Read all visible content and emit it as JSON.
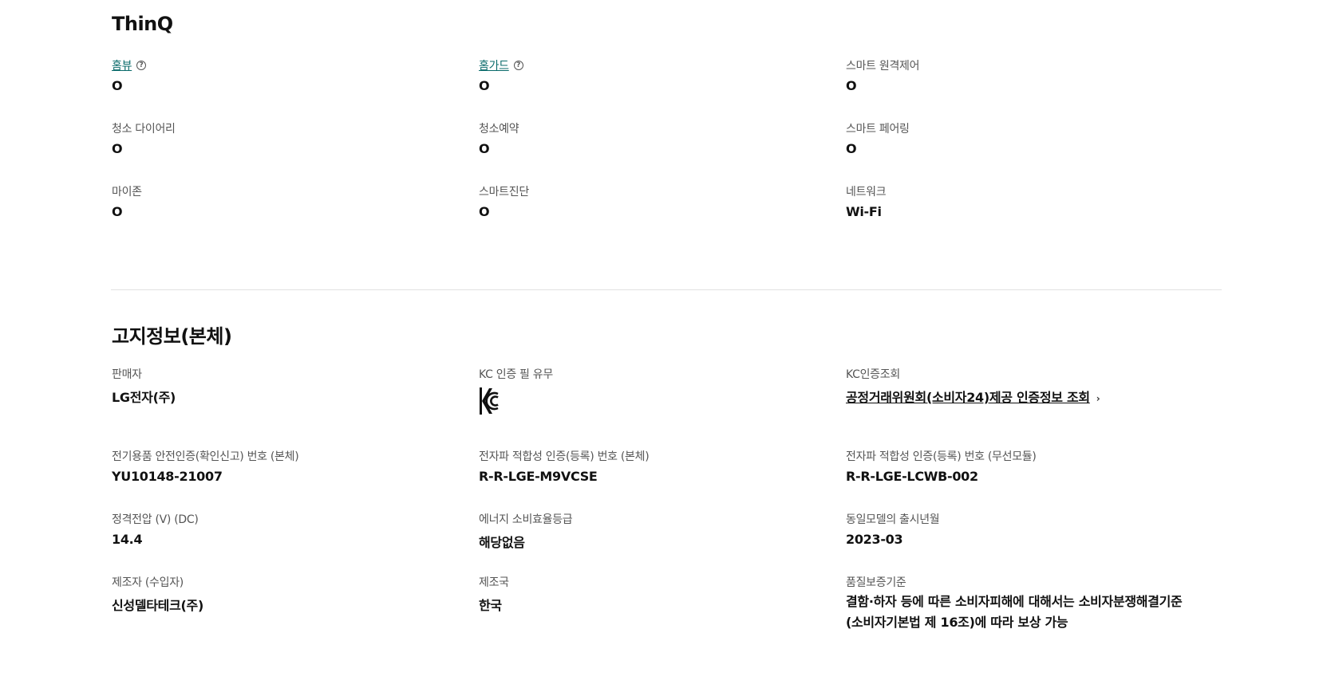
{
  "thinq": {
    "title": "ThinQ",
    "items": [
      {
        "label": "홈뷰",
        "value": "O"
      },
      {
        "label": "홈가드",
        "value": "O"
      },
      {
        "label": "스마트 원격제어",
        "value": "O"
      },
      {
        "label": "청소 다이어리",
        "value": "O"
      },
      {
        "label": "청소예약",
        "value": "O"
      },
      {
        "label": "스마트 페어링",
        "value": "O"
      },
      {
        "label": "마이존",
        "value": "O"
      },
      {
        "label": "스마트진단",
        "value": "O"
      },
      {
        "label": "네트워크",
        "value": "Wi-Fi"
      }
    ],
    "help_icon_name": "question-circle-icon"
  },
  "notice": {
    "title": "고지정보(본체)",
    "items": [
      {
        "label": "판매자",
        "value": "LG전자(주)"
      },
      {
        "label": "KC 인증 필 유무",
        "value_icon": "kc-certification-mark-icon"
      },
      {
        "label": "KC인증조회",
        "value": "공정거래위원회(소비자24)제공 인증정보 조회"
      },
      {
        "label": "전기용품 안전인증(확인신고) 번호 (본체)",
        "value": "YU10148-21007"
      },
      {
        "label": "전자파 적합성 인증(등록) 번호 (본체)",
        "value": "R-R-LGE-M9VCSE"
      },
      {
        "label": "전자파 적합성 인증(등록) 번호 (무선모듈)",
        "value": "R-R-LGE-LCWB-002"
      },
      {
        "label": "정격전압 (V) (DC)",
        "value": "14.4"
      },
      {
        "label": "에너지 소비효율등급",
        "value": "해당없음"
      },
      {
        "label": "동일모델의 출시년월",
        "value": "2023-03"
      },
      {
        "label": "제조자 (수입자)",
        "value": "신성델타테크(주)"
      },
      {
        "label": "제조국",
        "value": "한국"
      },
      {
        "label": "품질보증기준",
        "value": "결함·하자 등에 따른 소비자피해에 대해서는 소비자분쟁해결기준 (소비자기본법 제 16조)에 따라 보상 가능"
      }
    ],
    "chevron_icon_name": "chevron-right-icon"
  },
  "colors": {
    "link_teal": "#0a6b6b",
    "label_gray": "#555555",
    "divider": "#e2e2e2"
  }
}
